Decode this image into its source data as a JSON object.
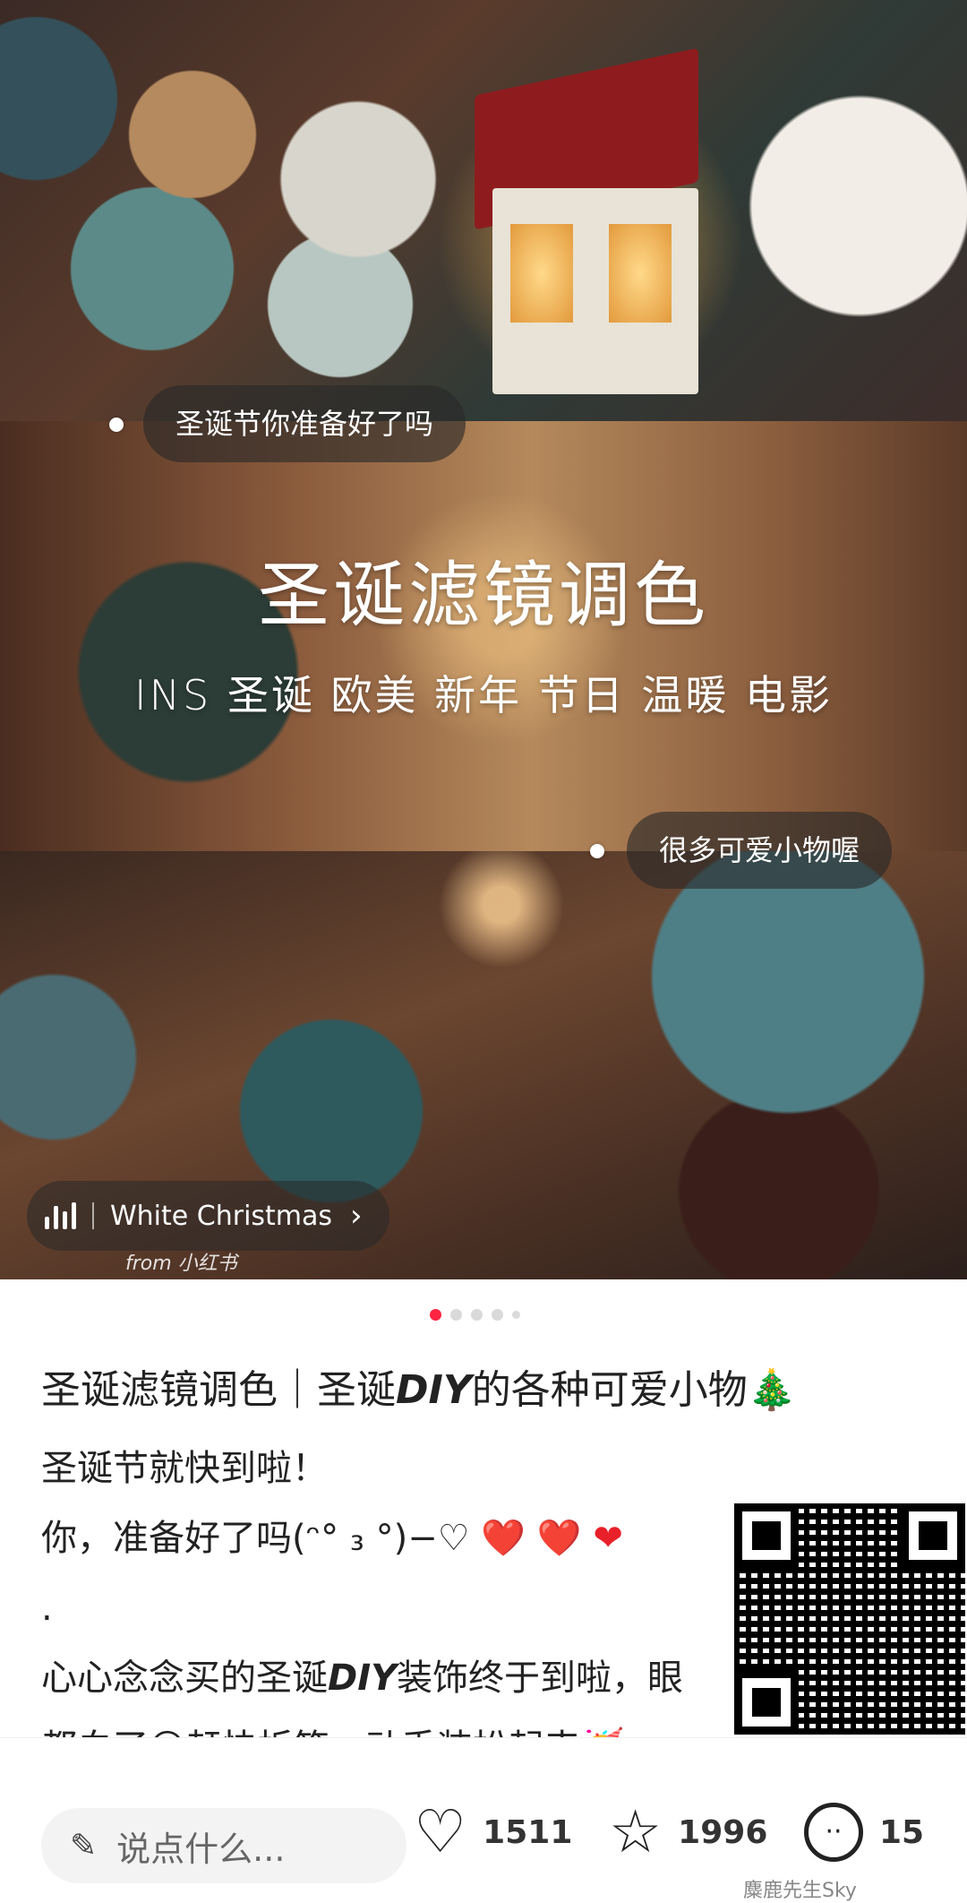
{
  "hero": {
    "headline": "圣诞滤镜调色",
    "tags": "INS 圣诞 欧美 新年 节日 温暖 电影",
    "bubble_top": "圣诞节你准备好了吗",
    "bubble_mid": "很多可爱小物喔",
    "music_title": "White Christmas",
    "music_chevron": "›",
    "watermark": "from 小红书"
  },
  "pagination": {
    "count": 5,
    "active": 0
  },
  "post": {
    "title_prefix": "圣诞滤镜调色｜圣诞",
    "title_em": "DIY",
    "title_suffix": "的各种可爱小物",
    "title_emoji": "🎄",
    "line1": "圣诞节就快到啦！",
    "line2_text": "你，准备好了吗(ᵔ° ₃ °)−♡ ",
    "line2_hearts": "❤️ ❤️ ❤",
    "line3": ".",
    "line4_prefix": "心心念念买的圣诞",
    "line4_em": "DIY",
    "line4_suffix": "装饰终于到啦，眼",
    "line5": "都白了😛赶快拆箱，动手装扮起来🥳"
  },
  "bottombar": {
    "comment_placeholder": "说点什么...",
    "likes": "1511",
    "stars": "1996",
    "comments": "15",
    "watermark": "麋鹿先生Sky"
  },
  "icons": {
    "pen": "pen-icon",
    "like": "heart-icon",
    "collect": "star-icon",
    "comment": "comment-icon",
    "music": "audio-bars-icon"
  },
  "colors": {
    "accent": "#ff2442",
    "heart": "#e8202a",
    "bubble_bg": "rgba(40,40,40,.62)"
  }
}
